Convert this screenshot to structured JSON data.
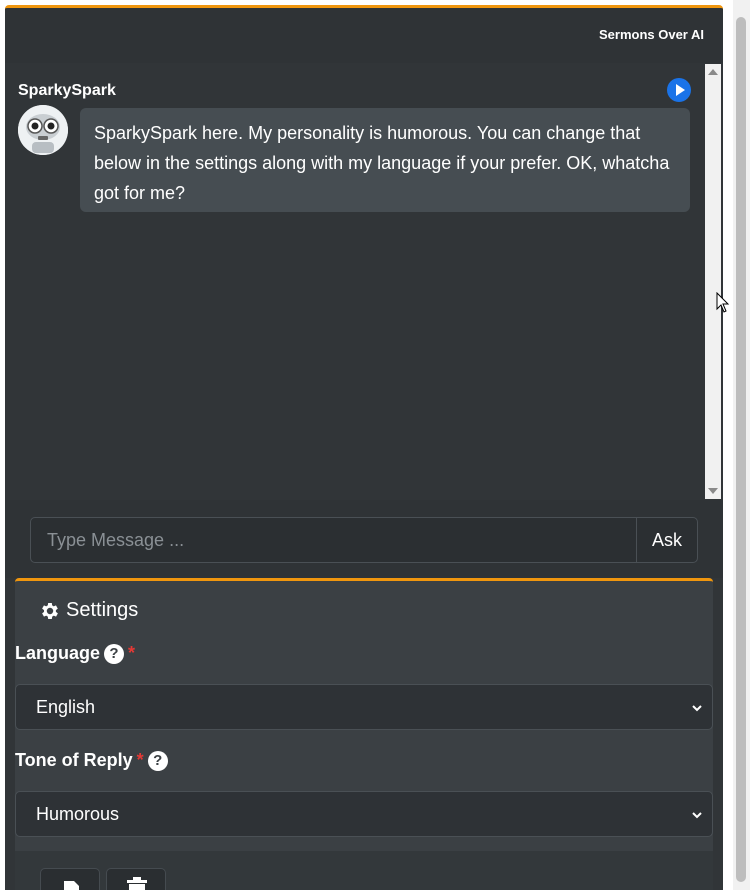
{
  "header": {
    "brand": "Sermons Over AI"
  },
  "chat": {
    "bot_name": "SparkySpark",
    "message": "SparkySpark here. My personality is humorous. You can change that below in the settings along with my language if your prefer. OK, whatcha got for me?",
    "play_icon": "play-circle-icon",
    "avatar_icon": "robot-avatar"
  },
  "input": {
    "placeholder": "Type Message ...",
    "ask_label": "Ask"
  },
  "settings": {
    "title": "Settings",
    "language": {
      "label": "Language",
      "required_mark": "*",
      "value": "English"
    },
    "tone": {
      "label": "Tone of Reply",
      "required_mark": "*",
      "value": "Humorous"
    }
  },
  "colors": {
    "accent": "#f0960e",
    "play": "#1a73e8",
    "required": "#e53935"
  }
}
